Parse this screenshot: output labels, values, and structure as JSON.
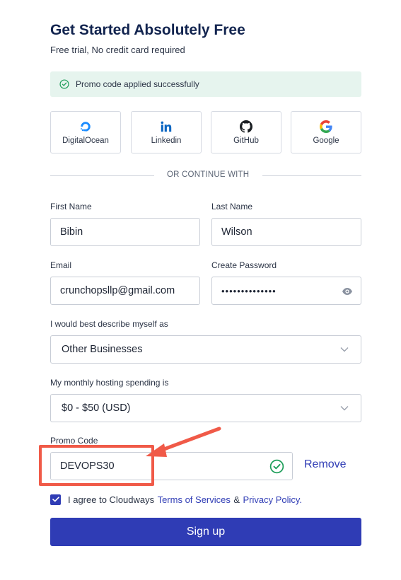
{
  "header": {
    "title": "Get Started Absolutely Free",
    "subtitle": "Free trial, No credit card required"
  },
  "promo_banner": {
    "message": "Promo code applied successfully",
    "color": "#e6f4ee"
  },
  "social_providers": [
    {
      "label": "DigitalOcean",
      "icon": "digitalocean-icon"
    },
    {
      "label": "Linkedin",
      "icon": "linkedin-icon"
    },
    {
      "label": "GitHub",
      "icon": "github-icon"
    },
    {
      "label": "Google",
      "icon": "google-icon"
    }
  ],
  "divider_text": "OR CONTINUE WITH",
  "form": {
    "first_name": {
      "label": "First Name",
      "value": "Bibin"
    },
    "last_name": {
      "label": "Last Name",
      "value": "Wilson"
    },
    "email": {
      "label": "Email",
      "value": "crunchopsllp@gmail.com"
    },
    "password": {
      "label": "Create Password",
      "value": "••••••••••••••"
    },
    "describe": {
      "label": "I would best describe myself as",
      "selected": "Other Businesses"
    },
    "spending": {
      "label": "My monthly hosting spending is",
      "selected": "$0 - $50 (USD)"
    },
    "promo": {
      "label": "Promo Code",
      "value": "DEVOPS30",
      "remove_label": "Remove"
    }
  },
  "agreement": {
    "checked": true,
    "prefix": "I agree to Cloudways",
    "terms": "Terms of Services",
    "amp": "&",
    "privacy": "Privacy Policy."
  },
  "signup_label": "Sign up",
  "colors": {
    "brand": "#2f3cb5",
    "success": "#1e9e5a",
    "annotation": "#f05a48"
  }
}
